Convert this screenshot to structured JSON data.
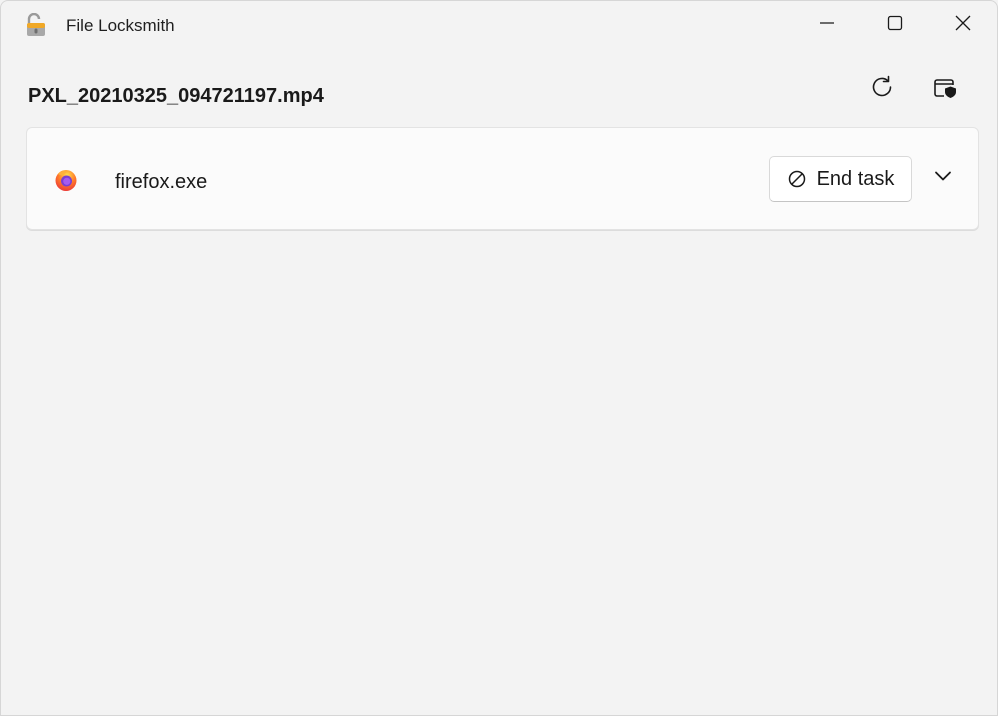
{
  "window": {
    "title": "File Locksmith",
    "app_icon": "unlocked-padlock-icon",
    "caption_buttons": [
      "minimize-icon",
      "maximize-icon",
      "close-icon"
    ]
  },
  "header": {
    "file_name": "PXL_20210325_094721197.mp4",
    "actions": [
      "reload-icon",
      "restart-as-admin-icon"
    ]
  },
  "processes": [
    {
      "name": "firefox.exe",
      "icon": "firefox-icon",
      "end_task_label": "End task",
      "end_task_icon": "block-icon",
      "expand_icon": "chevron-down-icon"
    }
  ],
  "colors": {
    "background": "#f3f3f3",
    "card": "#fbfbfb",
    "text": "#1a1a1a"
  }
}
